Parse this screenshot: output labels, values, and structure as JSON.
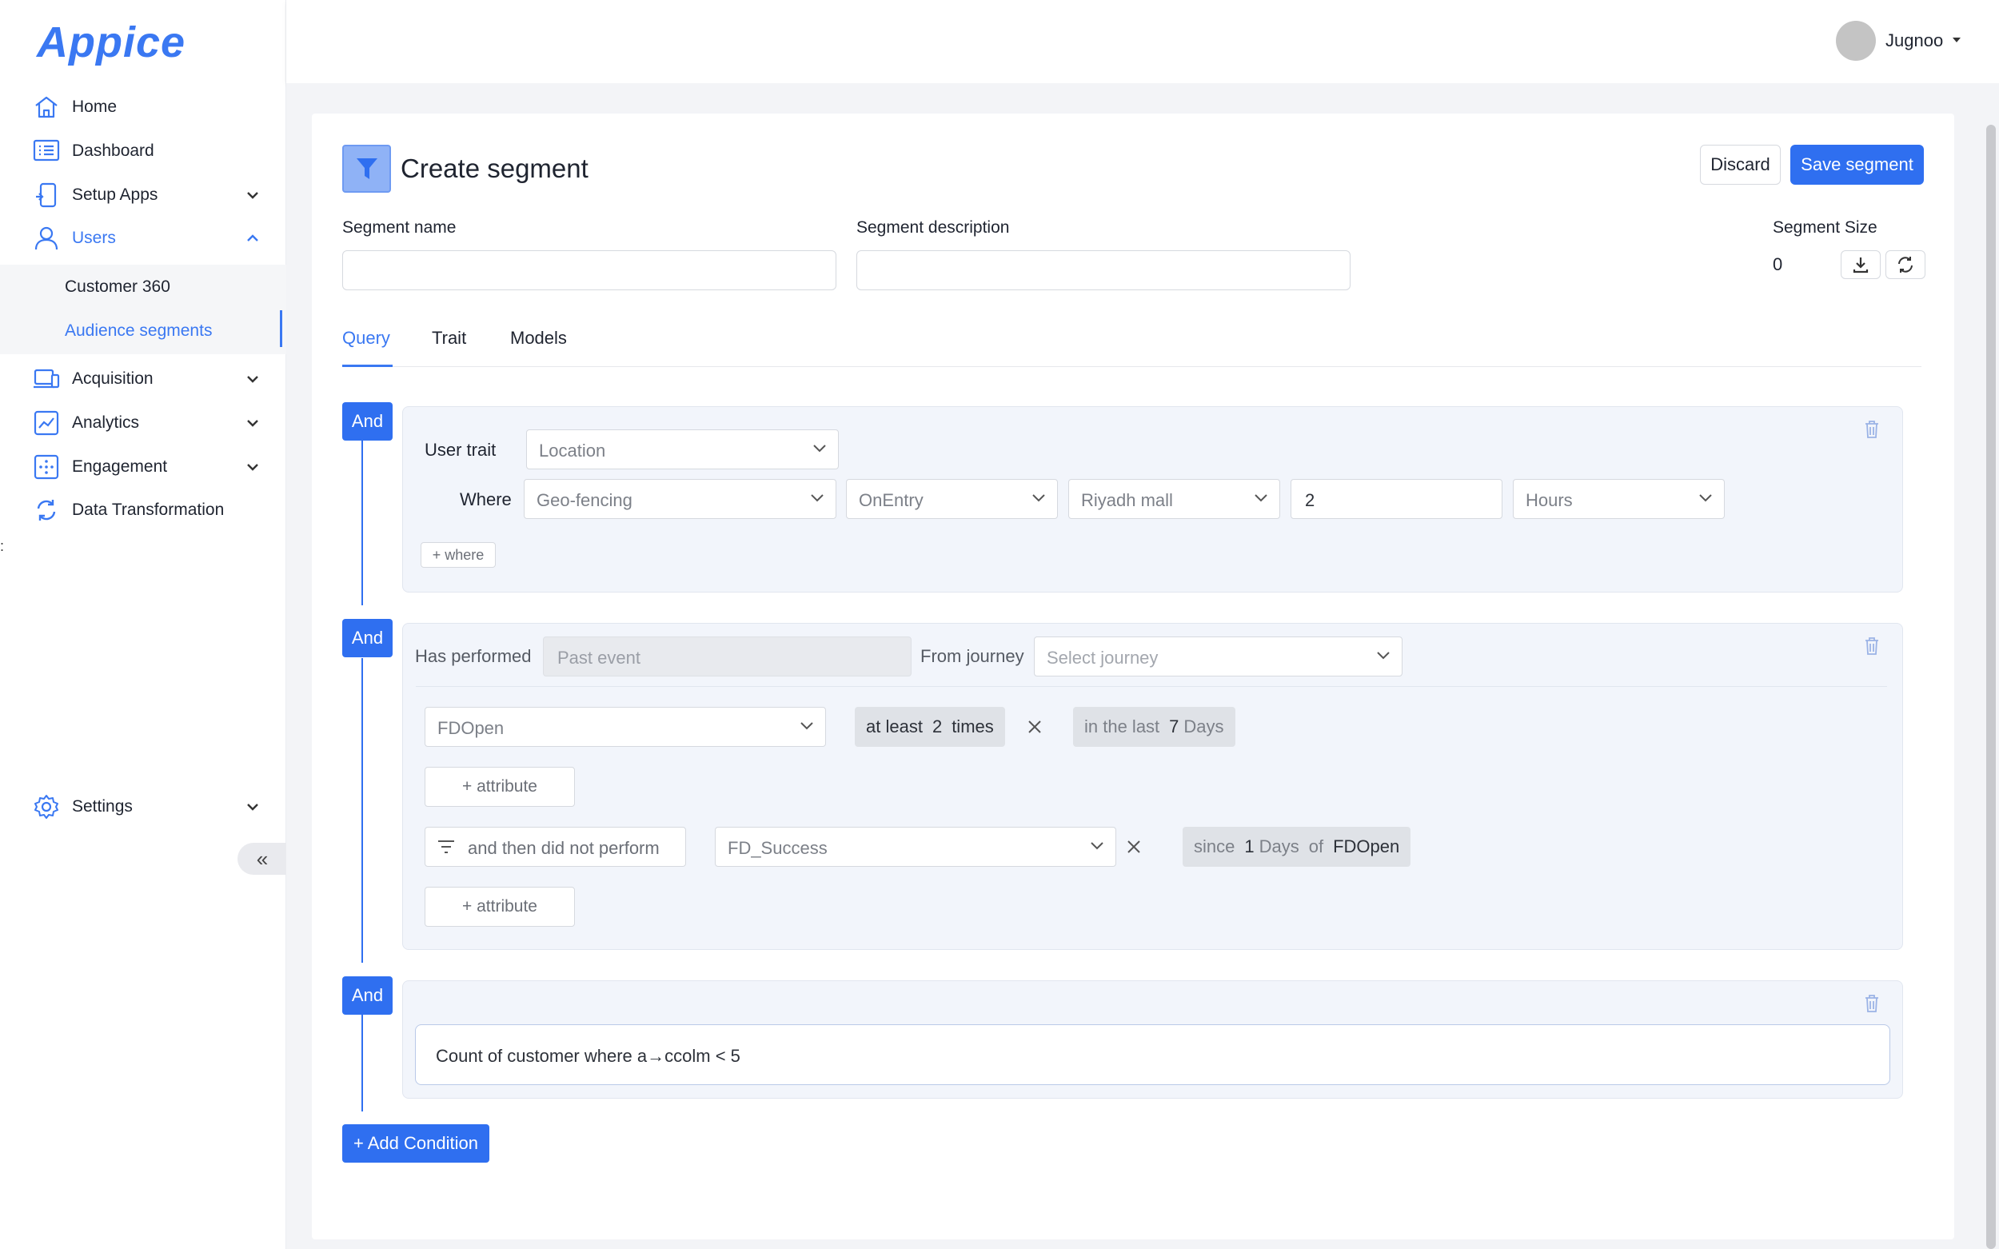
{
  "app": {
    "logo": "Appice"
  },
  "sidebar": {
    "items": [
      {
        "label": "Home",
        "icon": "home-icon"
      },
      {
        "label": "Dashboard",
        "icon": "dashboard-icon"
      },
      {
        "label": "Setup Apps",
        "icon": "setup-apps-icon"
      },
      {
        "label": "Users",
        "icon": "users-icon"
      },
      {
        "label": "Acquisition",
        "icon": "acquisition-icon"
      },
      {
        "label": "Analytics",
        "icon": "analytics-icon"
      },
      {
        "label": "Engagement",
        "icon": "engagement-icon"
      },
      {
        "label": "Data Transformation",
        "icon": "data-transformation-icon"
      },
      {
        "label": "Settings",
        "icon": "settings-icon"
      }
    ],
    "users_sub": [
      {
        "label": "Customer 360"
      },
      {
        "label": "Audience segments"
      }
    ],
    "collapse_glyph": "«",
    "stray_text": ":"
  },
  "topbar": {
    "user_name": "Jugnoo"
  },
  "page": {
    "title": "Create segment",
    "discard_label": "Discard",
    "save_label": "Save segment",
    "segment_name_label": "Segment name",
    "segment_description_label": "Segment description",
    "segment_size_label": "Segment Size",
    "segment_size_value": "0",
    "tabs": [
      {
        "label": "Query"
      },
      {
        "label": "Trait"
      },
      {
        "label": "Models"
      }
    ],
    "active_tab": "Query"
  },
  "conditions": {
    "and_label": "And",
    "block1": {
      "user_trait_label": "User trait",
      "trait_select": "Location",
      "where_label": "Where",
      "where_field": "Geo-fencing",
      "where_op": "OnEntry",
      "where_place": "Riyadh mall",
      "where_value": "2",
      "where_unit": "Hours",
      "add_where": "+ where"
    },
    "block2": {
      "has_performed_label": "Has performed",
      "past_event_placeholder": "Past event",
      "from_journey_label": "From journey",
      "journey_placeholder": "Select journey",
      "event1": "FDOpen",
      "freq": {
        "prefix": "at least",
        "count": "2",
        "suffix": "times"
      },
      "window": {
        "prefix": "in the last",
        "count": "7",
        "unit": "Days"
      },
      "add_attribute": "+ attribute",
      "then_label": "and then did not perform",
      "event2": "FD_Success",
      "since": {
        "prefix": "since",
        "count": "1",
        "unit": "Days",
        "of": "of",
        "event": "FDOpen"
      },
      "add_attribute2": "+ attribute"
    },
    "block3": {
      "query_text": "Count of customer where a→ccolm < 5"
    },
    "add_condition": "+ Add Condition"
  },
  "colors": {
    "accent": "#2f6ff0",
    "brand": "#3a78f2",
    "block_bg": "#f2f5fb"
  }
}
